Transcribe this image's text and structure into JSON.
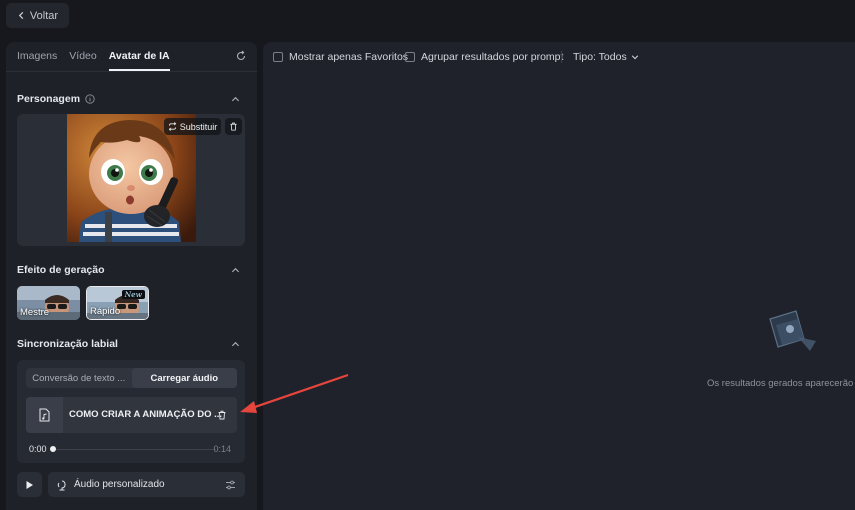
{
  "topbar": {
    "back_label": "Voltar"
  },
  "tabs": [
    {
      "label": "Imagens",
      "active": false
    },
    {
      "label": "Vídeo",
      "active": false
    },
    {
      "label": "Avatar de IA",
      "active": true
    }
  ],
  "character": {
    "title": "Personagem",
    "replace_label": "Substituir"
  },
  "effect": {
    "title": "Efeito de geração",
    "options": [
      {
        "label": "Mestre",
        "selected": false
      },
      {
        "label": "Rápido",
        "selected": true,
        "badge": "New"
      }
    ]
  },
  "lipsync": {
    "title": "Sincronização labial",
    "mode_tabs": [
      {
        "label": "Conversão de texto ...",
        "active": false
      },
      {
        "label": "Carregar áudio",
        "active": true
      }
    ],
    "file_name": "COMO CRIAR A ANIMAÇÃO DO ...",
    "time_current": "0:00",
    "time_total": "0:14",
    "progress": 0.0
  },
  "custom_audio": {
    "label": "Áudio personalizado"
  },
  "results": {
    "filters": {
      "favorites_label": "Mostrar apenas Favoritos",
      "group_label": "Agrupar resultados por prompt",
      "type_label": "Tipo: Todos"
    },
    "empty_text": "Os resultados gerados aparecerão a"
  },
  "colors": {
    "arrow": "#e5453c",
    "background": "#16181e",
    "panel": "#1e2128"
  }
}
